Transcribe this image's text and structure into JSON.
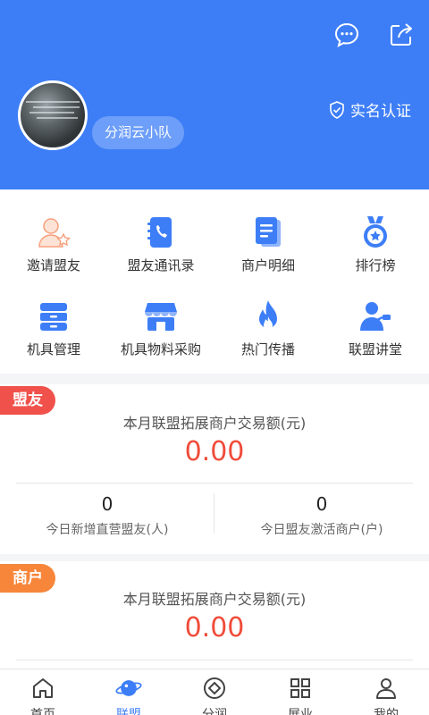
{
  "colors": {
    "primary": "#3d7ef7",
    "value_red": "#f04c3a",
    "tag_red": "#f0524b",
    "tag_orange": "#f7863a"
  },
  "header": {
    "team_name": "分润云小队",
    "verify_label": "实名认证",
    "icons": [
      "message-icon",
      "share-icon"
    ]
  },
  "menu": [
    {
      "label": "邀请盟友",
      "icon": "invite-user-icon"
    },
    {
      "label": "盟友通讯录",
      "icon": "contacts-icon"
    },
    {
      "label": "商户明细",
      "icon": "document-icon"
    },
    {
      "label": "排行榜",
      "icon": "medal-icon"
    },
    {
      "label": "机具管理",
      "icon": "cabinet-icon"
    },
    {
      "label": "机具物料采购",
      "icon": "store-icon"
    },
    {
      "label": "热门传播",
      "icon": "flame-icon"
    },
    {
      "label": "联盟讲堂",
      "icon": "lecturer-icon"
    }
  ],
  "ally_card": {
    "tag": "盟友",
    "title": "本月联盟拓展商户交易额(元)",
    "value": "0.00",
    "stats": [
      {
        "value": "0",
        "label": "今日新增直营盟友(人)"
      },
      {
        "value": "0",
        "label": "今日盟友激活商户(户)"
      }
    ]
  },
  "merchant_card": {
    "tag": "商户",
    "title": "本月联盟拓展商户交易额(元)",
    "value": "0.00"
  },
  "tabbar": [
    {
      "label": "首页",
      "icon": "home-icon",
      "active": false
    },
    {
      "label": "联盟",
      "icon": "planet-icon",
      "active": true
    },
    {
      "label": "分润",
      "icon": "coin-icon",
      "active": false
    },
    {
      "label": "展业",
      "icon": "grid-icon",
      "active": false
    },
    {
      "label": "我的",
      "icon": "user-icon",
      "active": false
    }
  ]
}
